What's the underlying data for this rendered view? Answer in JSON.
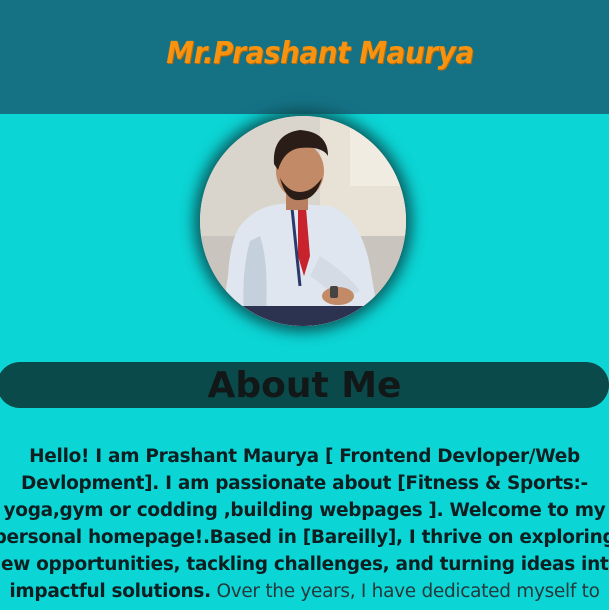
{
  "header": {
    "title": "Mr.Prashant Maurya"
  },
  "profile": {
    "photo_alt": "profile-photo"
  },
  "about": {
    "heading": "About Me",
    "bio_bold": "Hello! I am Prashant Maurya [ Frontend Devloper/Web Devlopment]. I am passionate about [Fitness & Sports:-yoga,gym or codding ,building webpages ]. Welcome to my personal homepage!.Based in [Bareilly], I thrive on exploring new opportunities, tackling challenges, and turning ideas into impactful solutions.",
    "bio_plain": " Over the years, I have dedicated myself to"
  },
  "colors": {
    "page_bg": "#0cd5d5",
    "header_bg": "#157285",
    "title_color": "#f7930f",
    "about_bar_bg": "#0a4a4a"
  }
}
